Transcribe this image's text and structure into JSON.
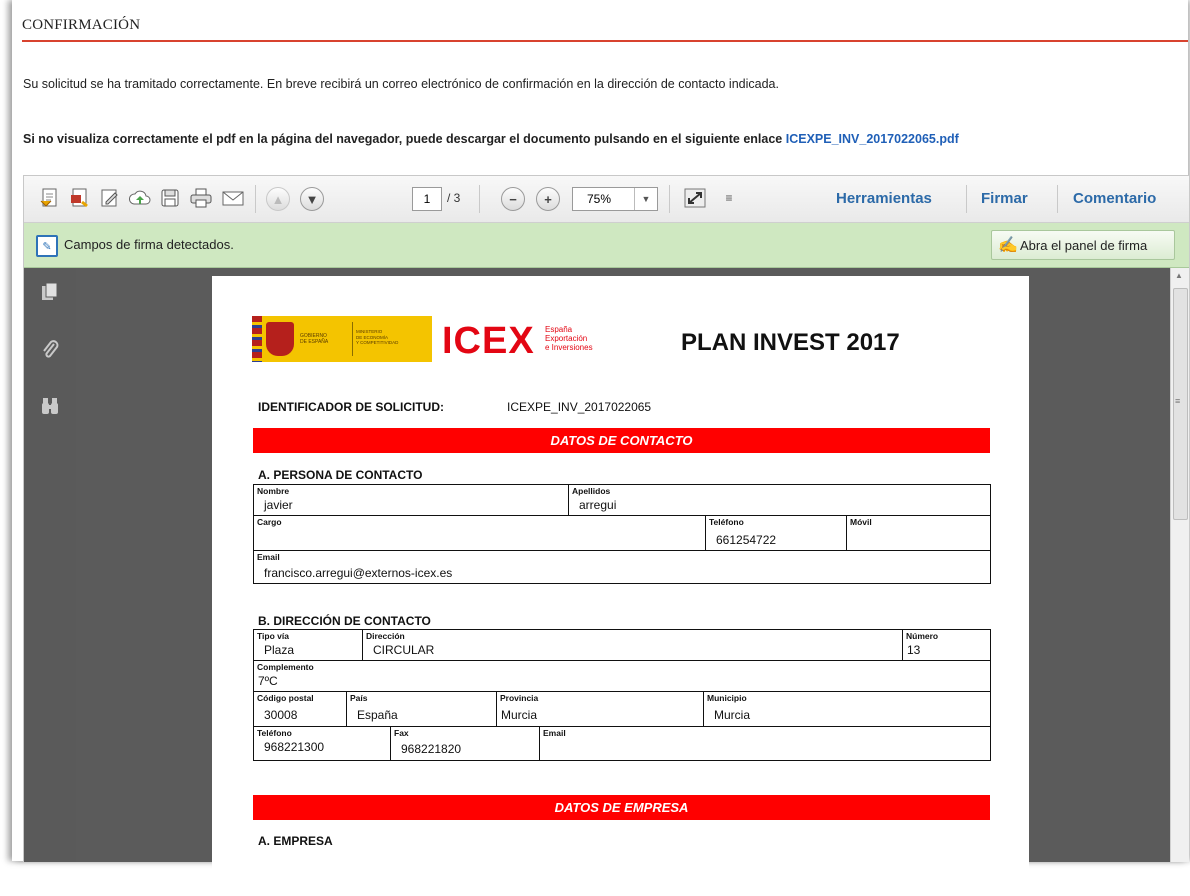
{
  "page": {
    "header": "CONFIRMACIÓN",
    "message": "Su solicitud se ha tramitado correctamente. En breve recibirá un correo electrónico de confirmación en la dirección de contacto indicada.",
    "download_text": "Si no visualiza correctamente el pdf en la página del navegador, puede descargar el documento pulsando en el siguiente enlace ",
    "download_link": "ICEXPE_INV_2017022065.pdf"
  },
  "toolbar": {
    "page_current": "1",
    "page_total": "/ 3",
    "zoom": "75%",
    "tools_label": "Herramientas",
    "sign_label": "Firmar",
    "comment_label": "Comentario",
    "icons": [
      "create-pdf-icon",
      "export-pdf-icon",
      "edit-icon",
      "cloud-upload-icon",
      "save-icon",
      "print-icon",
      "email-icon",
      "page-up-icon",
      "page-down-icon",
      "zoom-out-icon",
      "zoom-in-icon",
      "fullscreen-icon",
      "more-icon"
    ]
  },
  "signature_bar": {
    "message": "Campos de firma detectados.",
    "button": "Abra el panel de firma",
    "bg_color": "#cfe8c1"
  },
  "document": {
    "logo_gob": "GOBIERNO\nDE ESPAÑA",
    "logo_ministry": "MINISTERIO\nDE ECONOMÍA\nY COMPETITIVIDAD",
    "logo_brand": "ICEX",
    "logo_brand_sub": "España\nExportación\ne Inversiones",
    "title": "PLAN INVEST 2017",
    "id_label": "IDENTIFICADOR DE SOLICITUD:",
    "id_value": "ICEXPE_INV_2017022065",
    "contact_header": "DATOS DE CONTACTO",
    "person_section": "A. PERSONA DE CONTACTO",
    "person": {
      "nombre_l": "Nombre",
      "nombre_v": "javier",
      "apellidos_l": "Apellidos",
      "apellidos_v": "arregui",
      "cargo_l": "Cargo",
      "cargo_v": "",
      "telefono_l": "Teléfono",
      "telefono_v": "661254722",
      "movil_l": "Móvil",
      "movil_v": "",
      "email_l": "Email",
      "email_v": "francisco.arregui@externos-icex.es"
    },
    "address_section": "B. DIRECCIÓN DE CONTACTO",
    "address": {
      "tipovia_l": "Tipo vía",
      "tipovia_v": "Plaza",
      "direccion_l": "Dirección",
      "direccion_v": "CIRCULAR",
      "numero_l": "Número",
      "numero_v": "13",
      "complemento_l": "Complemento",
      "complemento_v": "7ºC",
      "cp_l": "Código postal",
      "cp_v": "30008",
      "pais_l": "País",
      "pais_v": "España",
      "provincia_l": "Provincia",
      "provincia_v": "Murcia",
      "municipio_l": "Municipio",
      "municipio_v": "Murcia",
      "telefono_l": "Teléfono",
      "telefono_v": "968221300",
      "fax_l": "Fax",
      "fax_v": "968221820",
      "email_l": "Email",
      "email_v": ""
    },
    "company_header": "DATOS DE EMPRESA",
    "company_section": "A. EMPRESA",
    "accent_color": "#ff0000"
  }
}
